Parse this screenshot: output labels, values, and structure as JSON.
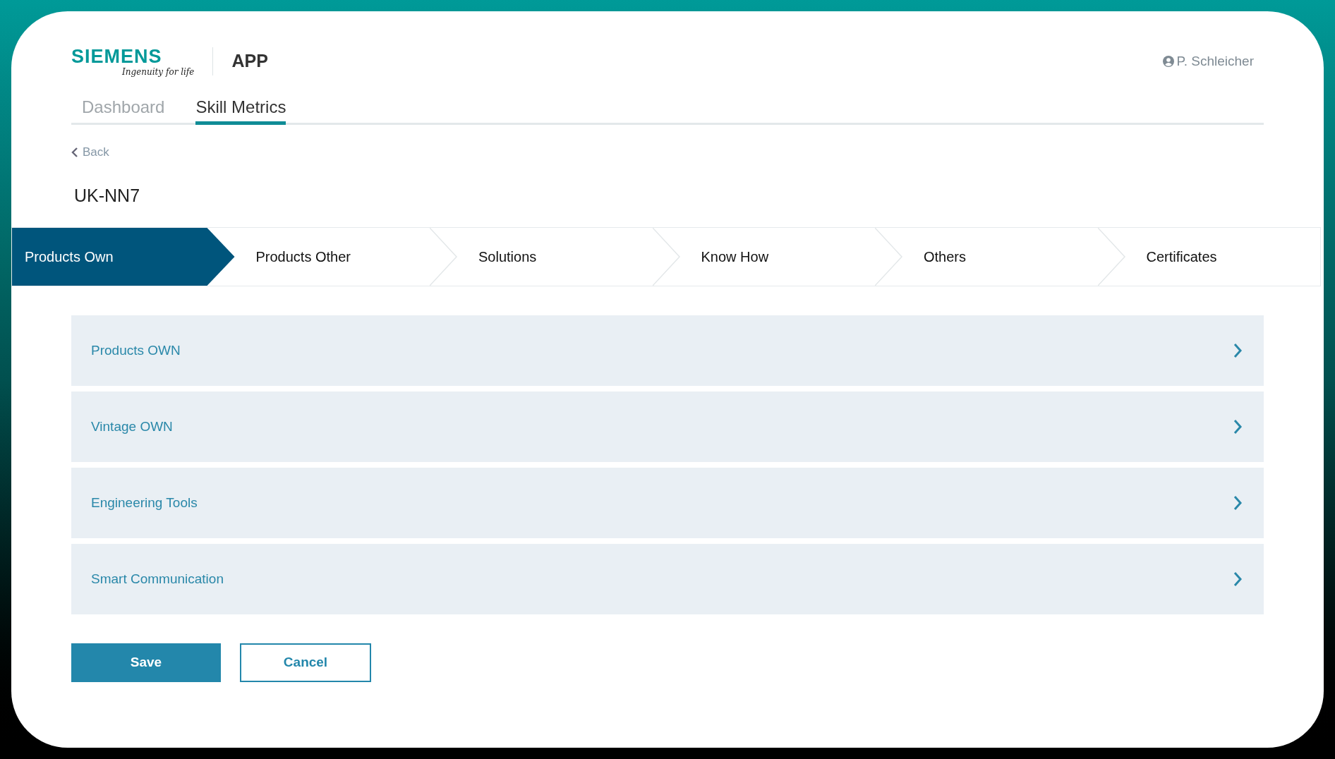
{
  "header": {
    "logo": "SIEMENS",
    "tagline": "Ingenuity for life",
    "app_name": "APP",
    "user": "P. Schleicher"
  },
  "tabs": [
    {
      "label": "Dashboard",
      "selected": false
    },
    {
      "label": "Skill Metrics",
      "selected": true
    }
  ],
  "back_link": "Back",
  "page_title": "UK-NN7",
  "steps": [
    {
      "label": "Products Own",
      "selected": true
    },
    {
      "label": "Products Other",
      "selected": false
    },
    {
      "label": "Solutions",
      "selected": false
    },
    {
      "label": "Know How",
      "selected": false
    },
    {
      "label": "Others",
      "selected": false
    },
    {
      "label": "Certificates",
      "selected": false
    }
  ],
  "categories": [
    "Products OWN",
    "Vintage OWN",
    "Engineering Tools",
    "Smart Communication"
  ],
  "buttons": [
    {
      "label": "Save",
      "kind": "primary"
    },
    {
      "label": "Cancel",
      "kind": "secondary"
    }
  ]
}
